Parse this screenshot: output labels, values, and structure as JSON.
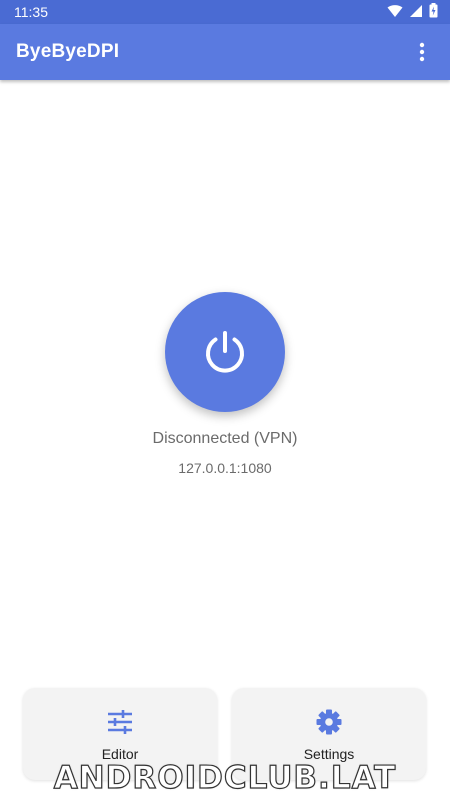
{
  "status_bar": {
    "time": "11:35"
  },
  "app_bar": {
    "title": "ByeByeDPI"
  },
  "main": {
    "status": "Disconnected (VPN)",
    "address": "127.0.0.1:1080"
  },
  "bottom": {
    "editor_label": "Editor",
    "settings_label": "Settings"
  },
  "watermark": "ANDROIDCLUB.LAT",
  "colors": {
    "accent": "#5a7ae0",
    "status_bar": "#4a6bd3"
  },
  "icons": {
    "menu": "more-vert-icon",
    "power": "power-icon",
    "editor": "tune-icon",
    "settings": "gear-icon"
  }
}
